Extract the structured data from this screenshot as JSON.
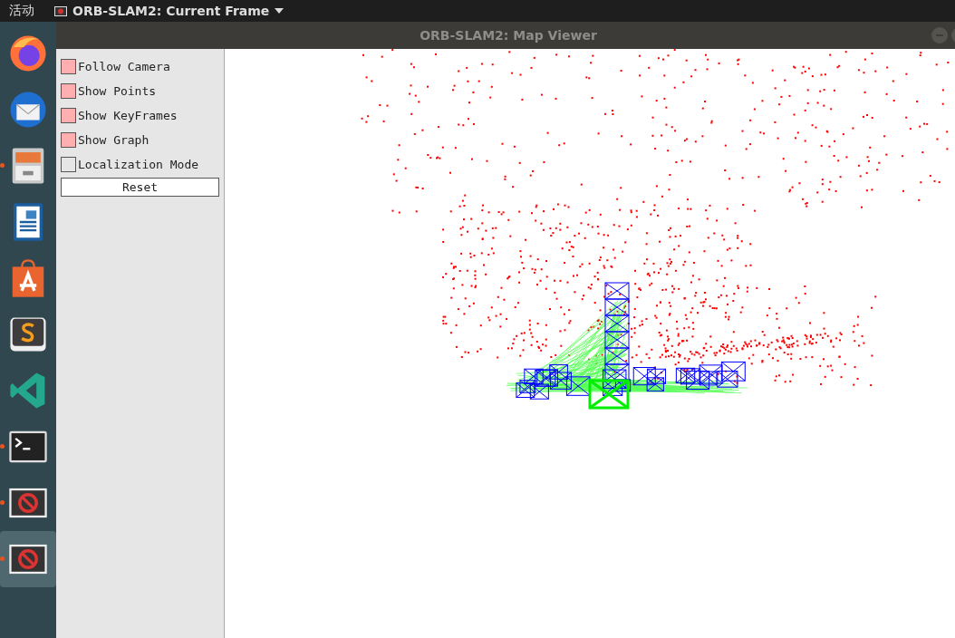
{
  "top_bar": {
    "activities": "活动",
    "app_menu": {
      "label": "ORB-SLAM2: Current Frame"
    }
  },
  "dock": [
    {
      "kind": "browser",
      "running": false,
      "selected": false
    },
    {
      "kind": "mail",
      "running": false,
      "selected": false
    },
    {
      "kind": "files",
      "running": true,
      "selected": false
    },
    {
      "kind": "document",
      "running": false,
      "selected": false
    },
    {
      "kind": "store",
      "running": false,
      "selected": false
    },
    {
      "kind": "editor",
      "running": false,
      "selected": false
    },
    {
      "kind": "code",
      "running": false,
      "selected": false
    },
    {
      "kind": "terminal",
      "running": true,
      "selected": false
    },
    {
      "kind": "app",
      "running": true,
      "selected": false
    },
    {
      "kind": "app",
      "running": true,
      "selected": true
    }
  ],
  "window": {
    "title": "ORB-SLAM2: Map Viewer"
  },
  "panel": {
    "options": [
      {
        "label": "Follow Camera",
        "checked": true
      },
      {
        "label": "Show Points",
        "checked": true
      },
      {
        "label": "Show KeyFrames",
        "checked": true
      },
      {
        "label": "Show Graph",
        "checked": true
      },
      {
        "label": "Localization Mode",
        "checked": false
      }
    ],
    "button": "Reset"
  }
}
